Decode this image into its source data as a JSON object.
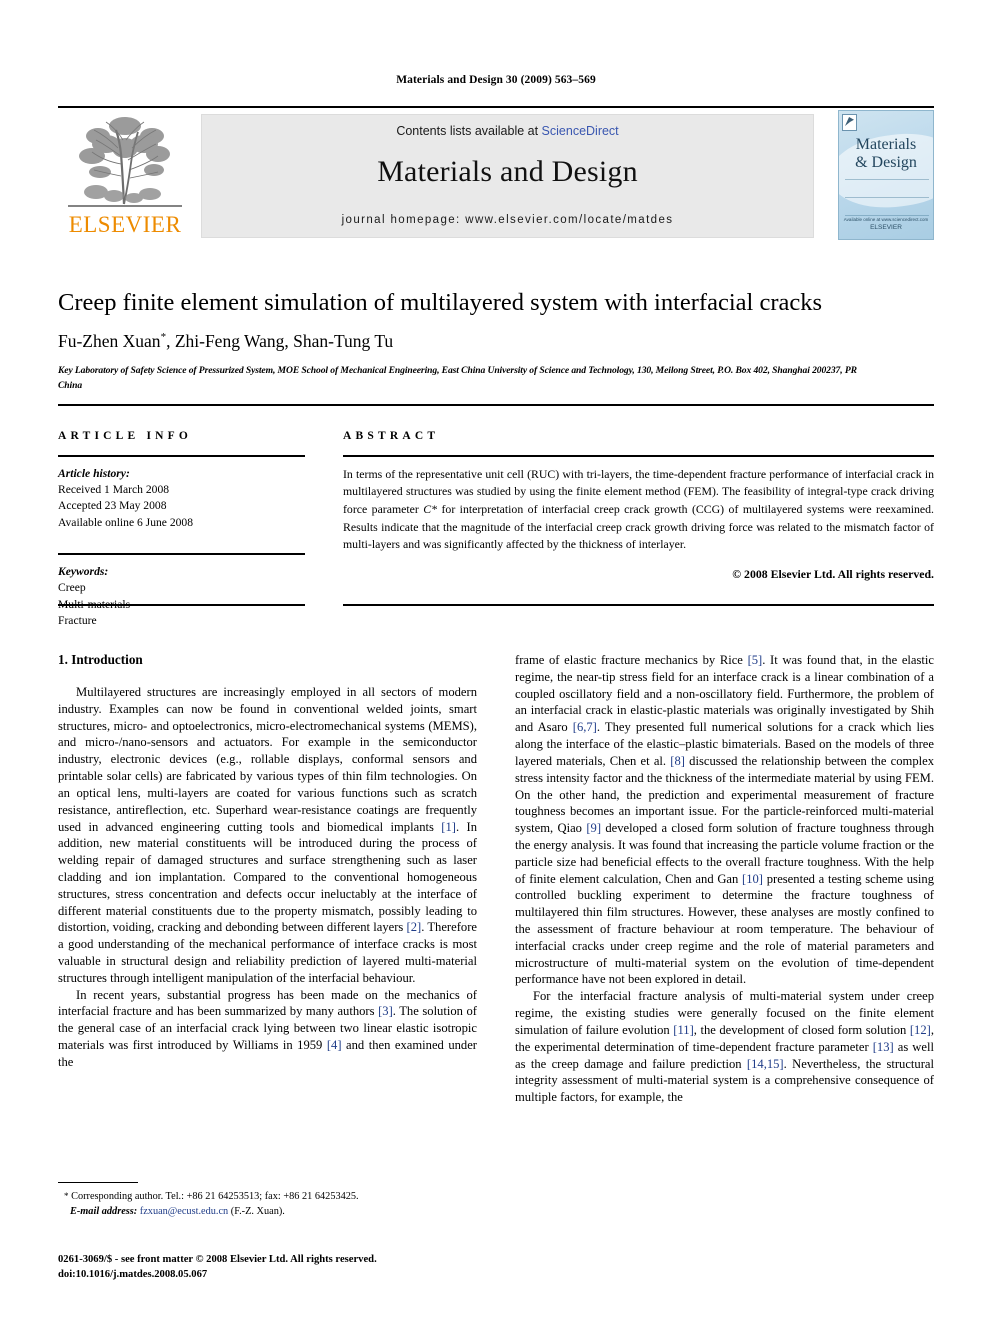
{
  "running_head": "Materials and Design 30 (2009) 563–569",
  "masthead": {
    "elsevier_wordmark": "ELSEVIER",
    "contents_prefix": "Contents lists available at ",
    "sciencedirect": "ScienceDirect",
    "journal_name": "Materials and Design",
    "homepage": "journal homepage: www.elsevier.com/locate/matdes",
    "cover": {
      "title_line1": "Materials",
      "title_line2": "& Design",
      "publisher_small": "ELSEVIER",
      "foot_small": "Available online at www.sciencedirect.com"
    },
    "sciencedirect_color": "#3a57b0",
    "elsevier_orange": "#ED8B00"
  },
  "article": {
    "title": "Creep finite element simulation of multilayered system with interfacial cracks",
    "authors": "Fu-Zhen Xuan",
    "corresponding_marker": "*",
    "authors_rest": ", Zhi-Feng Wang, Shan-Tung Tu",
    "affiliation": "Key Laboratory of Safety Science of Pressurized System, MOE School of Mechanical Engineering, East China University of Science and Technology, 130, Meilong Street, P.O. Box 402, Shanghai 200237, PR China"
  },
  "info": {
    "heading": "ARTICLE INFO",
    "history_label": "Article history:",
    "history": [
      "Received 1 March 2008",
      "Accepted 23 May 2008",
      "Available online 6 June 2008"
    ],
    "keywords_label": "Keywords:",
    "keywords": [
      "Creep",
      "Multi-materials",
      "Fracture"
    ]
  },
  "abstract": {
    "heading": "ABSTRACT",
    "part1": "In terms of the representative unit cell (RUC) with tri-layers, the time-dependent fracture performance of interfacial crack in multilayered structures was studied by using the finite element method (FEM). The feasibility of integral-type crack driving force parameter ",
    "param": "C*",
    "part2": " for interpretation of interfacial creep crack growth (CCG) of multilayered systems were reexamined. Results indicate that the magnitude of the interfacial creep crack growth driving force was related to the mismatch factor of multi-layers and was significantly affected by the thickness of interlayer.",
    "copyright": "© 2008 Elsevier Ltd. All rights reserved."
  },
  "body": {
    "section_heading": "1. Introduction",
    "left_paragraphs": [
      "Multilayered structures are increasingly employed in all sectors of modern industry. Examples can now be found in conventional welded joints, smart structures, micro- and optoelectronics, micro-electromechanical systems (MEMS), and micro-/nano-sensors and actuators. For example in the semiconductor industry, electronic devices (e.g., rollable displays, conformal sensors and printable solar cells) are fabricated by various types of thin film technologies. On an optical lens, multi-layers are coated for various functions such as scratch resistance, antireflection, etc. Superhard wear-resistance coatings are frequently used in advanced engineering cutting tools and biomedical implants [1]. In addition, new material constituents will be introduced during the process of welding repair of damaged structures and surface strengthening such as laser cladding and ion implantation. Compared to the conventional homogeneous structures, stress concentration and defects occur ineluctably at the interface of different material constituents due to the property mismatch, possibly leading to distortion, voiding, cracking and debonding between different layers [2]. Therefore a good understanding of the mechanical performance of interface cracks is most valuable in structural design and reliability prediction of layered multi-material structures through intelligent manipulation of the interfacial behaviour.",
      "In recent years, substantial progress has been made on the mechanics of interfacial fracture and has been summarized by many authors [3]. The solution of the general case of an interfacial crack lying between two linear elastic isotropic materials was first introduced by Williams in 1959 [4] and then examined under the"
    ],
    "right_paragraphs": [
      "frame of elastic fracture mechanics by Rice [5]. It was found that, in the elastic regime, the near-tip stress field for an interface crack is a linear combination of a coupled oscillatory field and a non-oscillatory field. Furthermore, the problem of an interfacial crack in elastic-plastic materials was originally investigated by Shih and Asaro [6,7]. They presented full numerical solutions for a crack which lies along the interface of the elastic–plastic bimaterials. Based on the models of three layered materials, Chen et al. [8] discussed the relationship between the complex stress intensity factor and the thickness of the intermediate material by using FEM. On the other hand, the prediction and experimental measurement of fracture toughness becomes an important issue. For the particle-reinforced multi-material system, Qiao [9] developed a closed form solution of fracture toughness through the energy analysis. It was found that increasing the particle volume fraction or the particle size had beneficial effects to the overall fracture toughness. With the help of finite element calculation, Chen and Gan [10] presented a testing scheme using controlled buckling experiment to determine the fracture toughness of multilayered thin film structures. However, these analyses are mostly confined to the assessment of fracture behaviour at room temperature. The behaviour of interfacial cracks under creep regime and the role of material parameters and microstructure of multi-material system on the evolution of time-dependent performance have not been explored in detail.",
      "For the interfacial fracture analysis of multi-material system under creep regime, the existing studies were generally focused on the finite element simulation of failure evolution [11], the development of closed form solution [12], the experimental determination of time-dependent fracture parameter [13] as well as the creep damage and failure prediction [14,15]. Nevertheless, the structural integrity assessment of multi-material system is a comprehensive consequence of multiple factors, for example, the"
    ]
  },
  "footnote": {
    "star": "*",
    "corresponding": "Corresponding author. Tel.: +86 21 64253513; fax: +86 21 64253425.",
    "email_label": "E-mail address:",
    "email": "fzxuan@ecust.edu.cn",
    "email_suffix": " (F.-Z. Xuan)."
  },
  "imprint": {
    "line1": "0261-3069/$ - see front matter © 2008 Elsevier Ltd. All rights reserved.",
    "line2": "doi:10.1016/j.matdes.2008.05.067"
  }
}
